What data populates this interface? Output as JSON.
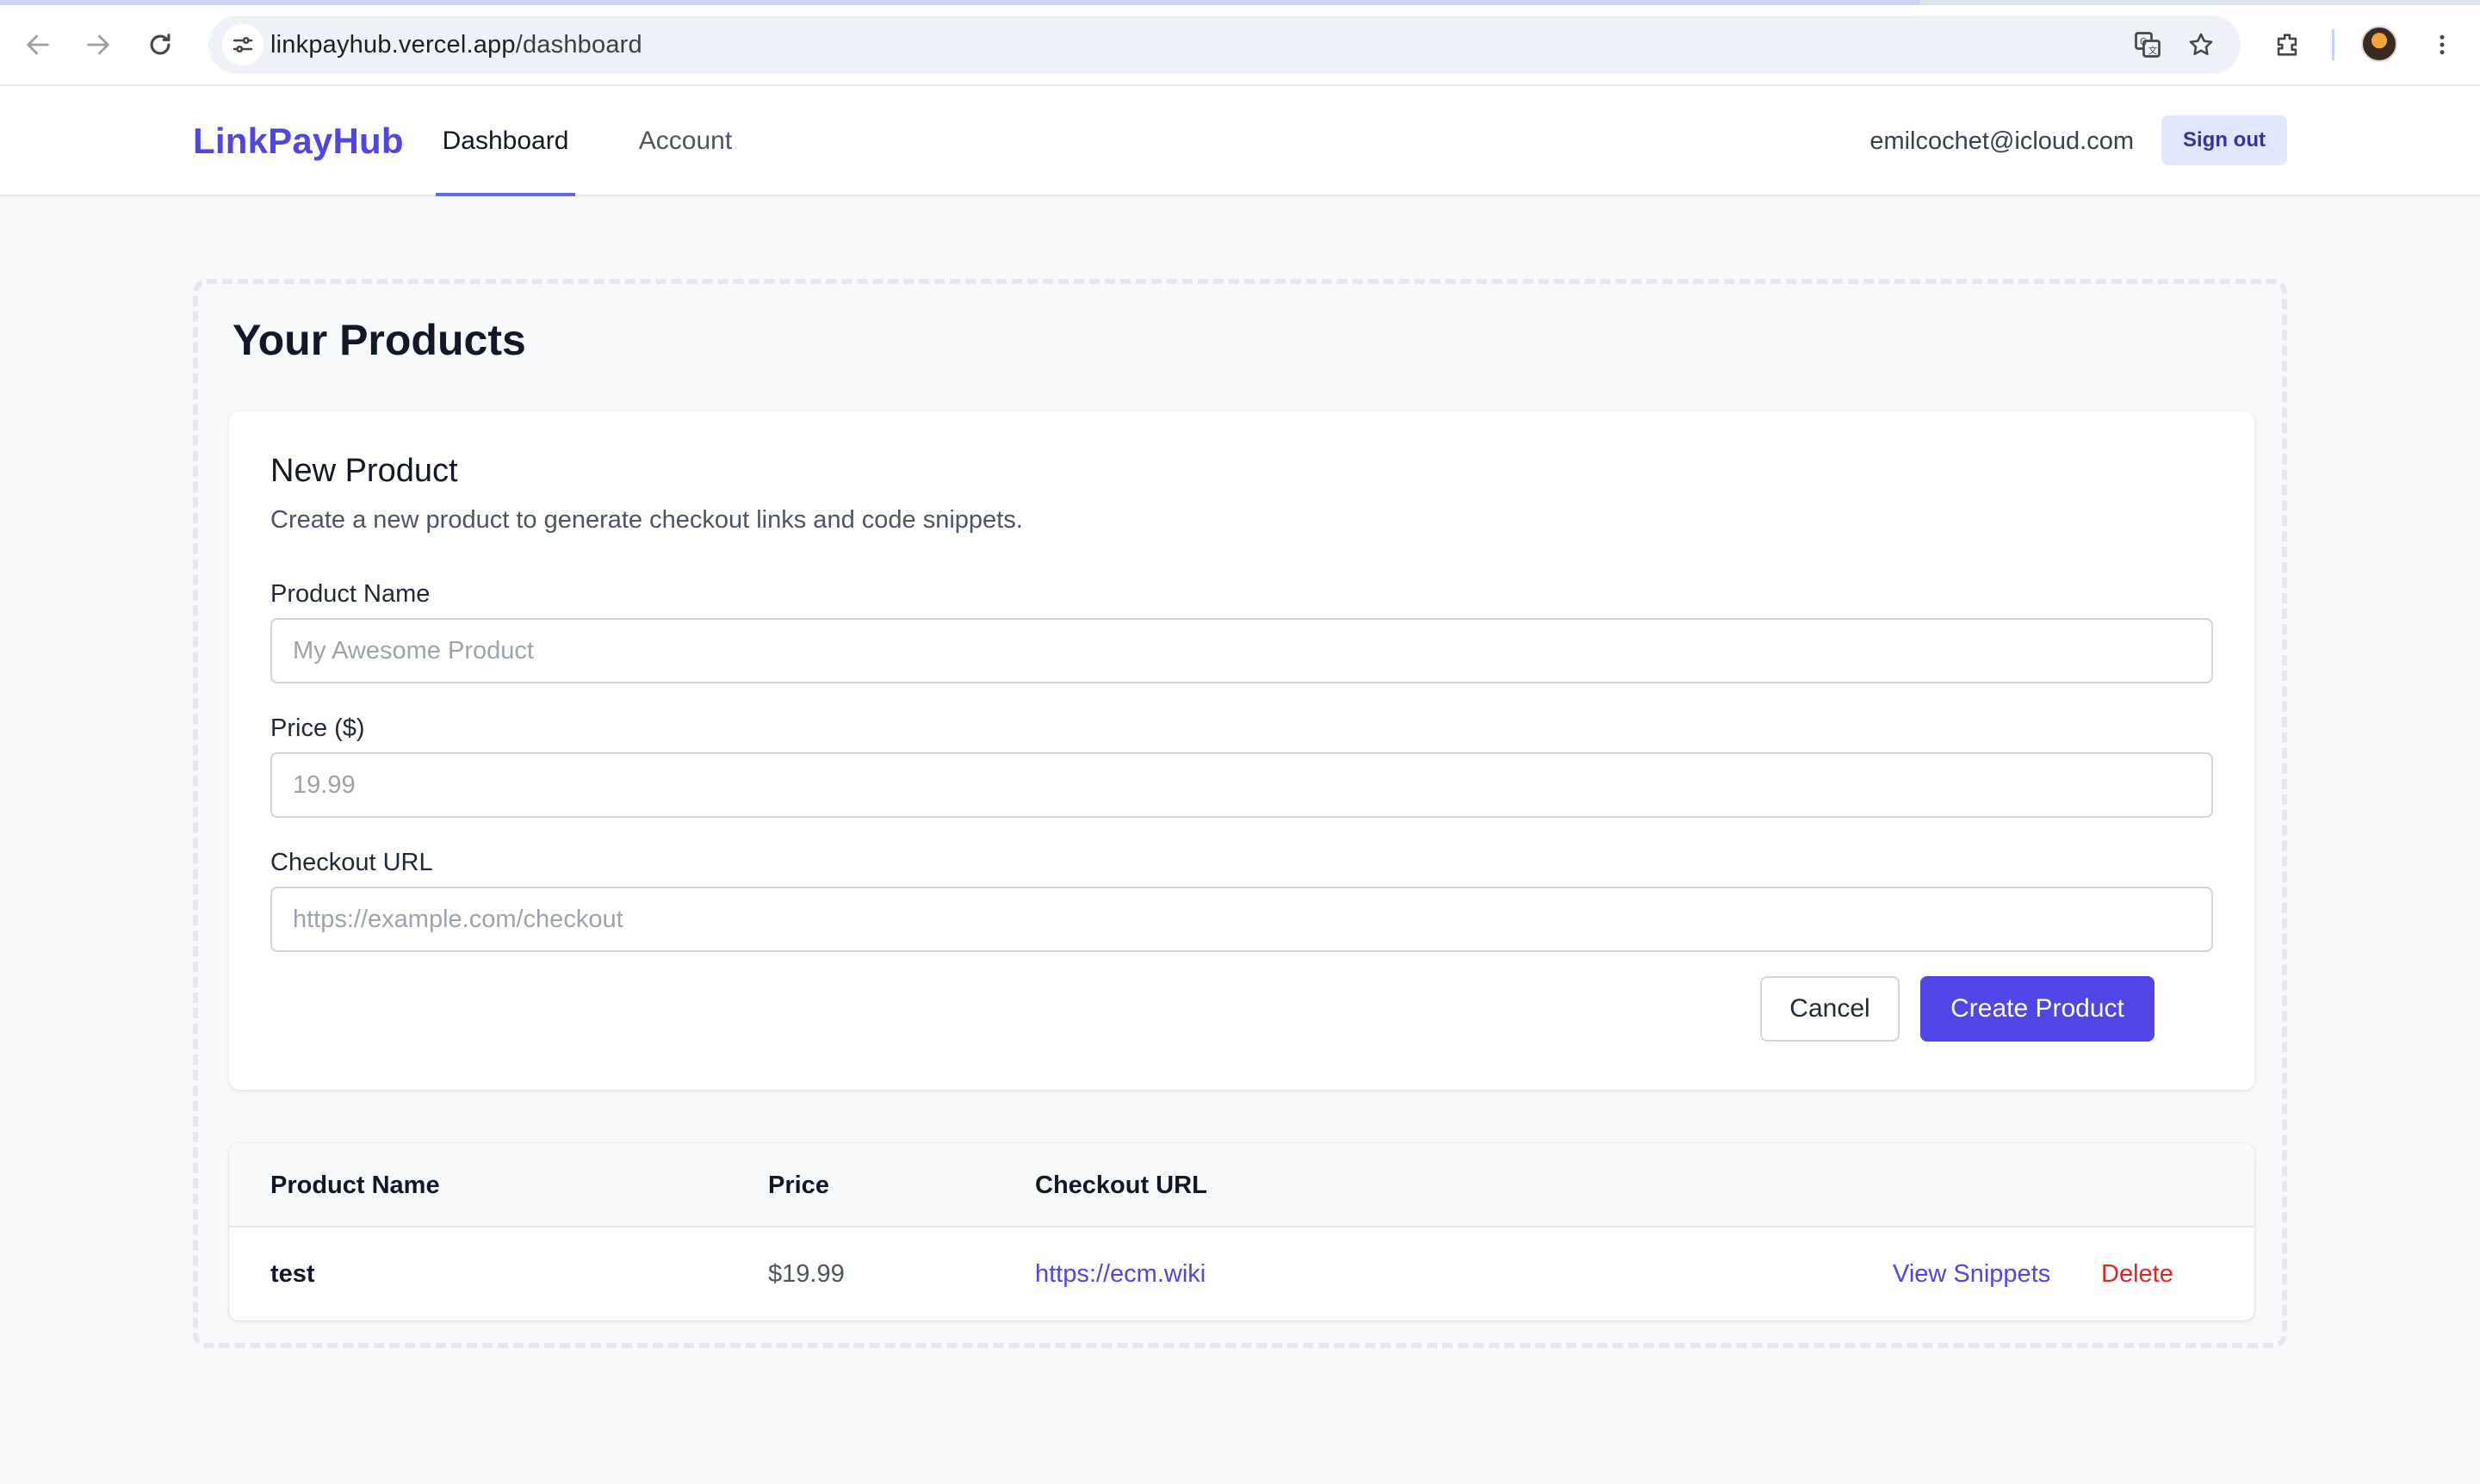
{
  "browser": {
    "url_host": "linkpayhub.vercel.app",
    "url_path": "/dashboard"
  },
  "header": {
    "brand": "LinkPayHub",
    "tabs": [
      {
        "label": "Dashboard",
        "active": true
      },
      {
        "label": "Account",
        "active": false
      }
    ],
    "user_email": "emilcochet@icloud.com",
    "sign_out_label": "Sign out"
  },
  "main": {
    "title": "Your Products",
    "new_product": {
      "title": "New Product",
      "description": "Create a new product to generate checkout links and code snippets.",
      "fields": [
        {
          "label": "Product Name",
          "placeholder": "My Awesome Product",
          "value": ""
        },
        {
          "label": "Price ($)",
          "placeholder": "19.99",
          "value": ""
        },
        {
          "label": "Checkout URL",
          "placeholder": "https://example.com/checkout",
          "value": ""
        }
      ],
      "cancel_label": "Cancel",
      "create_label": "Create Product"
    },
    "table": {
      "columns": [
        "Product Name",
        "Price",
        "Checkout URL"
      ],
      "rows": [
        {
          "name": "test",
          "price": "$19.99",
          "checkout_url": "https://ecm.wiki",
          "actions": [
            "View Snippets",
            "Delete"
          ]
        }
      ]
    }
  },
  "colors": {
    "accent": "#4f46e5",
    "danger": "#dc2626",
    "page_bg": "#f8f9fb"
  }
}
